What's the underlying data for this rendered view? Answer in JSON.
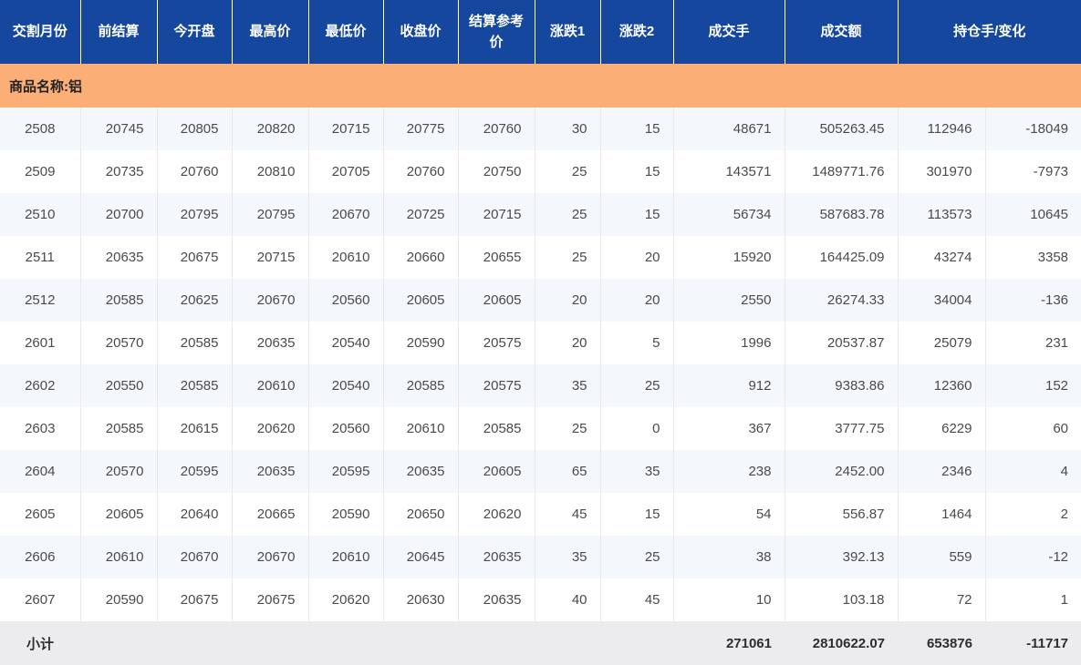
{
  "colors": {
    "header_bg": "#15479e",
    "banner_bg": "#fbae76",
    "row_alt_bg": "#f4f7fb",
    "subtotal_bg": "#ececee"
  },
  "product_banner": {
    "label": "商品名称:铝"
  },
  "table": {
    "headers": [
      {
        "label": "交割月份"
      },
      {
        "label": "前结算"
      },
      {
        "label": "今开盘"
      },
      {
        "label": "最高价"
      },
      {
        "label": "最低价"
      },
      {
        "label": "收盘价"
      },
      {
        "label": "结算参考价"
      },
      {
        "label": "涨跌1"
      },
      {
        "label": "涨跌2"
      },
      {
        "label": "成交手"
      },
      {
        "label": "成交额"
      },
      {
        "label": "持仓手/变化",
        "colspan": 2
      }
    ],
    "rows": [
      [
        "2508",
        "20745",
        "20805",
        "20820",
        "20715",
        "20775",
        "20760",
        "30",
        "15",
        "48671",
        "505263.45",
        "112946",
        "-18049"
      ],
      [
        "2509",
        "20735",
        "20760",
        "20810",
        "20705",
        "20760",
        "20750",
        "25",
        "15",
        "143571",
        "1489771.76",
        "301970",
        "-7973"
      ],
      [
        "2510",
        "20700",
        "20795",
        "20795",
        "20670",
        "20725",
        "20715",
        "25",
        "15",
        "56734",
        "587683.78",
        "113573",
        "10645"
      ],
      [
        "2511",
        "20635",
        "20675",
        "20715",
        "20610",
        "20660",
        "20655",
        "25",
        "20",
        "15920",
        "164425.09",
        "43274",
        "3358"
      ],
      [
        "2512",
        "20585",
        "20625",
        "20670",
        "20560",
        "20605",
        "20605",
        "20",
        "20",
        "2550",
        "26274.33",
        "34004",
        "-136"
      ],
      [
        "2601",
        "20570",
        "20585",
        "20635",
        "20540",
        "20590",
        "20575",
        "20",
        "5",
        "1996",
        "20537.87",
        "25079",
        "231"
      ],
      [
        "2602",
        "20550",
        "20585",
        "20610",
        "20540",
        "20585",
        "20575",
        "35",
        "25",
        "912",
        "9383.86",
        "12360",
        "152"
      ],
      [
        "2603",
        "20585",
        "20615",
        "20620",
        "20560",
        "20610",
        "20585",
        "25",
        "0",
        "367",
        "3777.75",
        "6229",
        "60"
      ],
      [
        "2604",
        "20570",
        "20595",
        "20635",
        "20595",
        "20635",
        "20605",
        "65",
        "35",
        "238",
        "2452.00",
        "2346",
        "4"
      ],
      [
        "2605",
        "20605",
        "20640",
        "20665",
        "20590",
        "20650",
        "20620",
        "45",
        "15",
        "54",
        "556.87",
        "1464",
        "2"
      ],
      [
        "2606",
        "20610",
        "20670",
        "20670",
        "20610",
        "20645",
        "20635",
        "35",
        "25",
        "38",
        "392.13",
        "559",
        "-12"
      ],
      [
        "2607",
        "20590",
        "20675",
        "20675",
        "20620",
        "20630",
        "20635",
        "40",
        "45",
        "10",
        "103.18",
        "72",
        "1"
      ]
    ],
    "subtotal": {
      "label": "小计",
      "volume": "271061",
      "turnover": "2810622.07",
      "open_interest": "653876",
      "oi_change": "-11717"
    }
  }
}
